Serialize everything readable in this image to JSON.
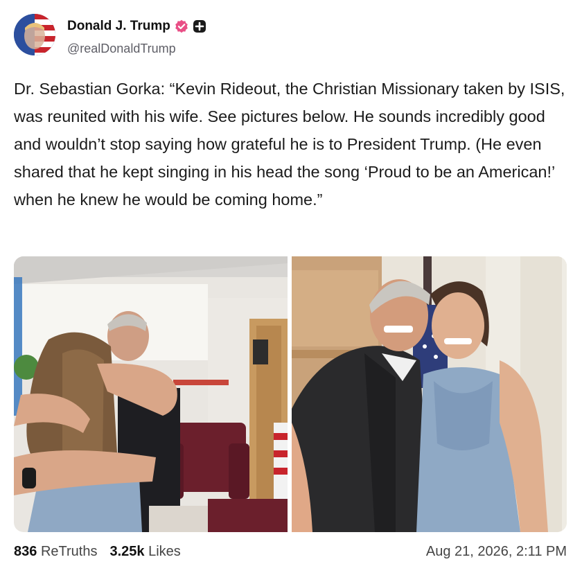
{
  "author": {
    "display_name": "Donald J. Trump",
    "handle": "@realDonaldTrump",
    "verified_icon": "verified-badge-icon",
    "extra_icon": "plus-badge-icon",
    "badge_color": "#e94f86"
  },
  "post": {
    "text": "Dr. Sebastian Gorka: “Kevin Rideout, the Christian Missionary taken by ISIS, was reunited with his wife. See pictures below. He sounds incredibly good and wouldn’t stop saying how grateful he is to President Trump. (He even shared that he kept singing in his head the song ‘Proud to be an American!’ when he knew he would be coming home.”"
  },
  "media": [
    {
      "name": "photo-hug"
    },
    {
      "name": "photo-couple"
    }
  ],
  "stats": {
    "retruths_count": "836",
    "retruths_label": "ReTruths",
    "likes_count": "3.25k",
    "likes_label": "Likes"
  },
  "timestamp": "Aug 21, 2026, 2:11 PM"
}
